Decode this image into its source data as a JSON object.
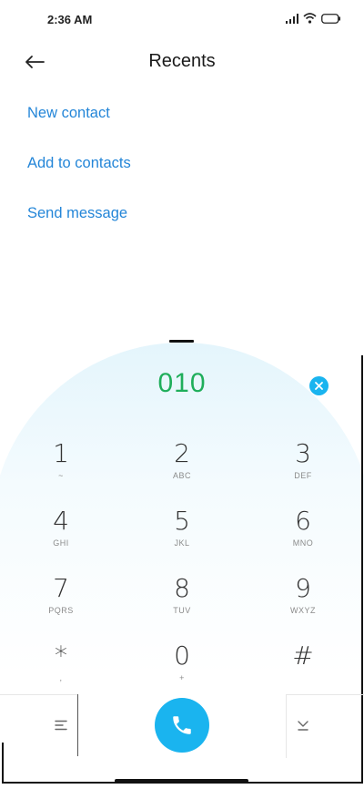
{
  "status_bar": {
    "time": "2:36 AM"
  },
  "header": {
    "title": "Recents"
  },
  "actions": [
    {
      "label": "New contact"
    },
    {
      "label": "Add to contacts"
    },
    {
      "label": "Send message"
    }
  ],
  "dialer": {
    "number": "010",
    "keys": [
      {
        "digit": "1",
        "letters": "~"
      },
      {
        "digit": "2",
        "letters": "ABC"
      },
      {
        "digit": "3",
        "letters": "DEF"
      },
      {
        "digit": "4",
        "letters": "GHI"
      },
      {
        "digit": "5",
        "letters": "JKL"
      },
      {
        "digit": "6",
        "letters": "MNO"
      },
      {
        "digit": "7",
        "letters": "PQRS"
      },
      {
        "digit": "8",
        "letters": "TUV"
      },
      {
        "digit": "9",
        "letters": "WXYZ"
      },
      {
        "digit": "*",
        "letters": ","
      },
      {
        "digit": "0",
        "letters": "+"
      },
      {
        "digit": "#",
        "letters": ""
      }
    ]
  },
  "colors": {
    "accent": "#1ab4ef",
    "link": "#2486d8",
    "number": "#1fae5b"
  }
}
